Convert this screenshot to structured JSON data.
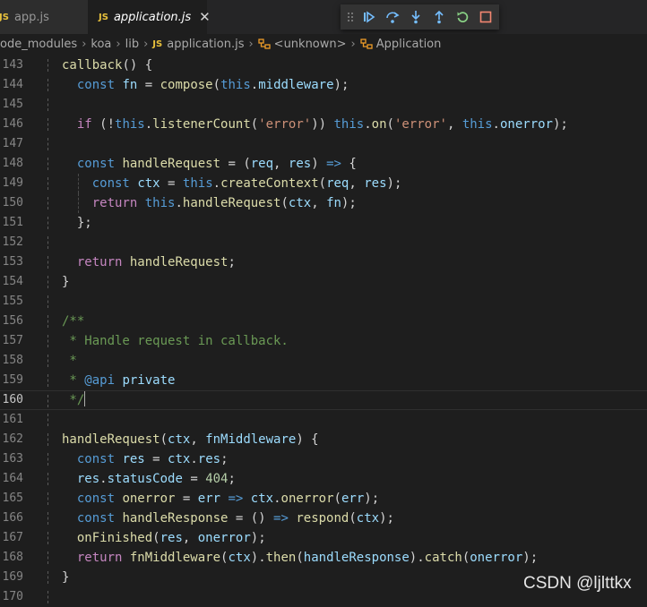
{
  "tabs": [
    {
      "label": "app.js",
      "active": false
    },
    {
      "label": "application.js",
      "active": true,
      "badge": "JS"
    }
  ],
  "breadcrumb": [
    "ode_modules",
    "koa",
    "lib",
    "application.js",
    "<unknown>",
    "Application"
  ],
  "debug_toolbar": [
    "drag-handle",
    "continue",
    "step-over",
    "step-into",
    "step-out",
    "restart",
    "stop"
  ],
  "colors": {
    "keyword": "#569cd6",
    "function": "#dcdcaa",
    "variable": "#9cdcfe",
    "string": "#ce9178",
    "number": "#b5cea8",
    "comment": "#6a9955",
    "badge": "#e8c13c",
    "debug_blue": "#75beff",
    "debug_green": "#89d185",
    "debug_red": "#f48771"
  },
  "lines": [
    {
      "n": "143",
      "text": "callback() {"
    },
    {
      "n": "144",
      "text": "const fn = compose(this.middleware);"
    },
    {
      "n": "145",
      "text": ""
    },
    {
      "n": "146",
      "text": "if (!this.listenerCount('error')) this.on('error', this.onerror);"
    },
    {
      "n": "147",
      "text": ""
    },
    {
      "n": "148",
      "text": "const handleRequest = (req, res) => {"
    },
    {
      "n": "149",
      "text": "const ctx = this.createContext(req, res);"
    },
    {
      "n": "150",
      "text": "return this.handleRequest(ctx, fn);"
    },
    {
      "n": "151",
      "text": "};"
    },
    {
      "n": "152",
      "text": ""
    },
    {
      "n": "153",
      "text": "return handleRequest;"
    },
    {
      "n": "154",
      "text": "}"
    },
    {
      "n": "155",
      "text": ""
    },
    {
      "n": "156",
      "text": "/**"
    },
    {
      "n": "157",
      "text": "* Handle request in callback."
    },
    {
      "n": "158",
      "text": "*"
    },
    {
      "n": "159",
      "text": "* @api private"
    },
    {
      "n": "160",
      "text": "*/"
    },
    {
      "n": "161",
      "text": ""
    },
    {
      "n": "162",
      "text": "handleRequest(ctx, fnMiddleware) {"
    },
    {
      "n": "163",
      "text": "const res = ctx.res;"
    },
    {
      "n": "164",
      "text": "res.statusCode = 404;"
    },
    {
      "n": "165",
      "text": "const onerror = err => ctx.onerror(err);"
    },
    {
      "n": "166",
      "text": "const handleResponse = () => respond(ctx);"
    },
    {
      "n": "167",
      "text": "onFinished(res, onerror);"
    },
    {
      "n": "168",
      "text": "return fnMiddleware(ctx).then(handleResponse).catch(onerror);"
    },
    {
      "n": "169",
      "text": "}"
    },
    {
      "n": "170",
      "text": ""
    }
  ],
  "watermark": "CSDN @ljlttkx"
}
